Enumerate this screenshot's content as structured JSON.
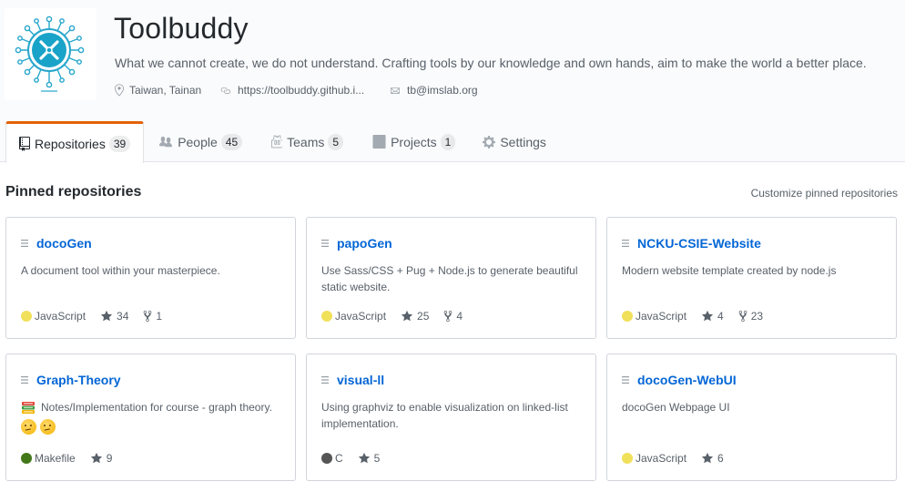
{
  "org": {
    "name": "Toolbuddy",
    "description": "What we cannot create, we do not understand. Crafting tools by our knowledge and own hands, aim to make the world a better place.",
    "location": "Taiwan, Tainan",
    "website": "https://toolbuddy.github.i...",
    "email": "tb@imslab.org"
  },
  "tabs": [
    {
      "label": "Repositories",
      "count": "39",
      "icon": "repo-icon",
      "selected": true
    },
    {
      "label": "People",
      "count": "45",
      "icon": "people-icon"
    },
    {
      "label": "Teams",
      "count": "5",
      "icon": "jersey-icon"
    },
    {
      "label": "Projects",
      "count": "1",
      "icon": "project-icon"
    },
    {
      "label": "Settings",
      "icon": "gear-icon"
    }
  ],
  "pinned": {
    "title": "Pinned repositories",
    "customize_label": "Customize pinned repositories",
    "repos": [
      {
        "name": "docoGen",
        "description": "A document tool within your masterpiece.",
        "language": "JavaScript",
        "lang_color": "#f1e05a",
        "stars": "34",
        "forks": "1"
      },
      {
        "name": "papoGen",
        "description": "Use Sass/CSS + Pug + Node.js to generate beautiful static website.",
        "language": "JavaScript",
        "lang_color": "#f1e05a",
        "stars": "25",
        "forks": "4"
      },
      {
        "name": "NCKU-CSIE-Website",
        "description": "Modern website template created by node.js",
        "language": "JavaScript",
        "lang_color": "#f1e05a",
        "stars": "4",
        "forks": "23"
      },
      {
        "name": "Graph-Theory",
        "description": "Notes/Implementation for course - graph theory.",
        "language": "Makefile",
        "lang_color": "#427819",
        "stars": "9"
      },
      {
        "name": "visual-ll",
        "description": "Using graphviz to enable visualization on linked-list implementation.",
        "language": "C",
        "lang_color": "#555555",
        "stars": "5"
      },
      {
        "name": "docoGen-WebUI",
        "description": "docoGen Webpage UI",
        "language": "JavaScript",
        "lang_color": "#f1e05a",
        "stars": "6"
      }
    ]
  },
  "colors": {
    "accent": "#e36209",
    "link": "#0366d6",
    "logo": "#1aa3c8"
  }
}
